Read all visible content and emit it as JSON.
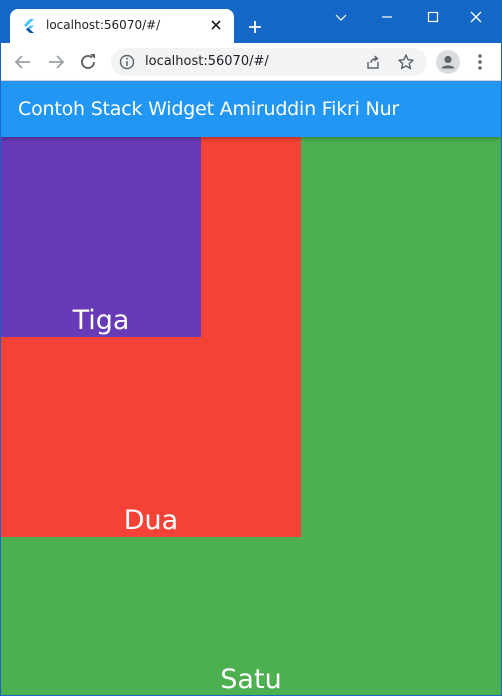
{
  "browser": {
    "tab_title": "localhost:56070/#/",
    "url": "localhost:56070/#/",
    "frame_color": "#1467c7"
  },
  "app": {
    "title": "Contoh Stack Widget Amiruddin Fikri Nur",
    "appbar_color": "#2196f3",
    "boxes": [
      {
        "label": "Satu",
        "color": "#4caf50"
      },
      {
        "label": "Dua",
        "color": "#f44336"
      },
      {
        "label": "Tiga",
        "color": "#673ab7"
      }
    ]
  }
}
